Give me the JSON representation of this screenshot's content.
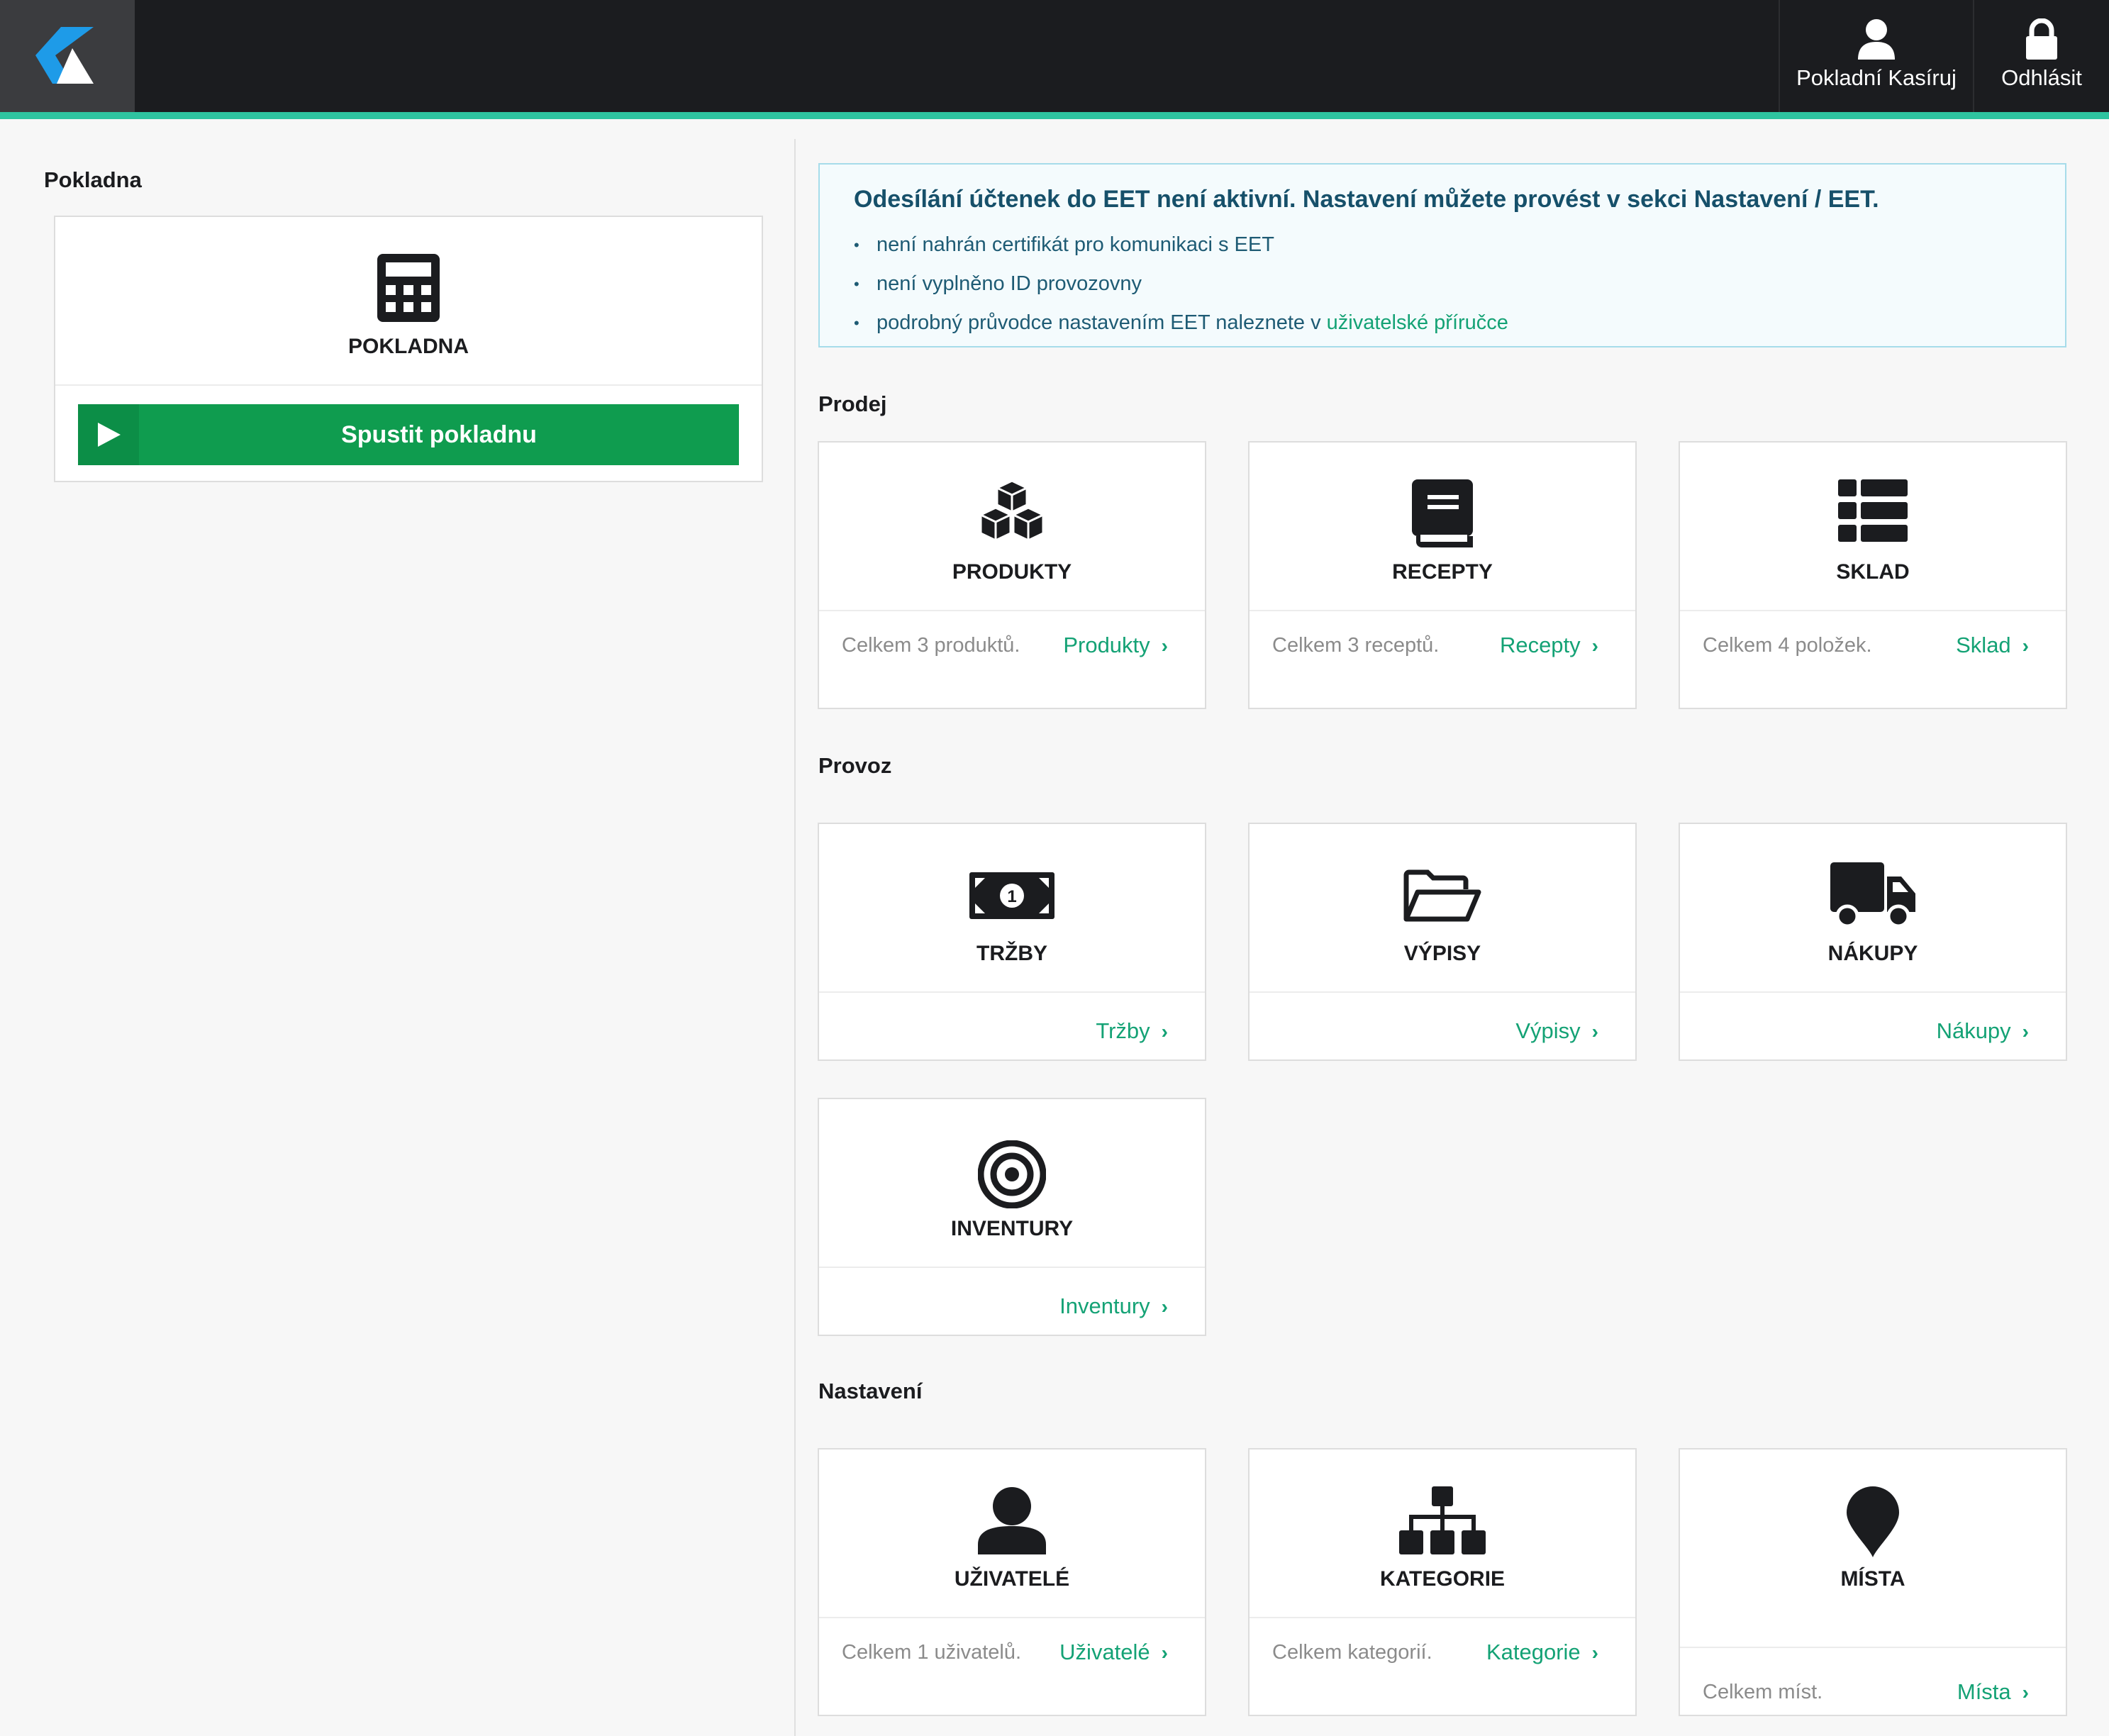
{
  "topbar": {
    "user_label": "Pokladní Kasíruj",
    "logout_label": "Odhlásit",
    "logo_icon": "k-logo",
    "accent_color": "#2ec4a0"
  },
  "left": {
    "section_title": "Pokladna",
    "card_title": "POKLADNA",
    "run_label": "Spustit pokladnu",
    "run_color": "#0f9c4f"
  },
  "alert": {
    "heading": "Odesílání účtenek do EET není aktivní. Nastavení můžete provést v sekci Nastavení / EET.",
    "item_1": "není nahrán certifikát pro komunikaci s EET",
    "item_2": "není vyplněno ID provozovny",
    "item_3_text": "podrobný průvodce nastavením EET naleznete v ",
    "item_3_link": "uživatelské příručce"
  },
  "sections": {
    "prodej": "Prodej",
    "provoz": "Provoz",
    "nastaveni": "Nastavení"
  },
  "tiles": {
    "produkty": {
      "title": "PRODUKTY",
      "desc": "Celkem 3 produktů.",
      "link": "Produkty",
      "icon": "cubes-icon"
    },
    "recepty": {
      "title": "RECEPTY",
      "desc": "Celkem 3 receptů.",
      "link": "Recepty",
      "icon": "book-icon"
    },
    "sklad": {
      "title": "SKLAD",
      "desc": "Celkem 4 položek.",
      "link": "Sklad",
      "icon": "list-icon"
    },
    "trzby": {
      "title": "TRŽBY",
      "link": "Tržby",
      "icon": "money-icon"
    },
    "vypisy": {
      "title": "VÝPISY",
      "link": "Výpisy",
      "icon": "folder-open-icon"
    },
    "nakupy": {
      "title": "NÁKUPY",
      "link": "Nákupy",
      "icon": "truck-icon"
    },
    "inventury": {
      "title": "INVENTURY",
      "link": "Inventury",
      "icon": "target-icon"
    },
    "uzivatele": {
      "title": "UŽIVATELÉ",
      "desc": "Celkem 1 uživatelů.",
      "link": "Uživatelé",
      "icon": "user-icon"
    },
    "kategorie": {
      "title": "KATEGORIE",
      "desc": "Celkem kategorií.",
      "link": "Kategorie",
      "icon": "sitemap-icon"
    },
    "mista": {
      "title": "MÍSTA",
      "desc": "Celkem míst.",
      "link": "Místa",
      "icon": "map-marker-icon"
    }
  },
  "chevron": "›"
}
